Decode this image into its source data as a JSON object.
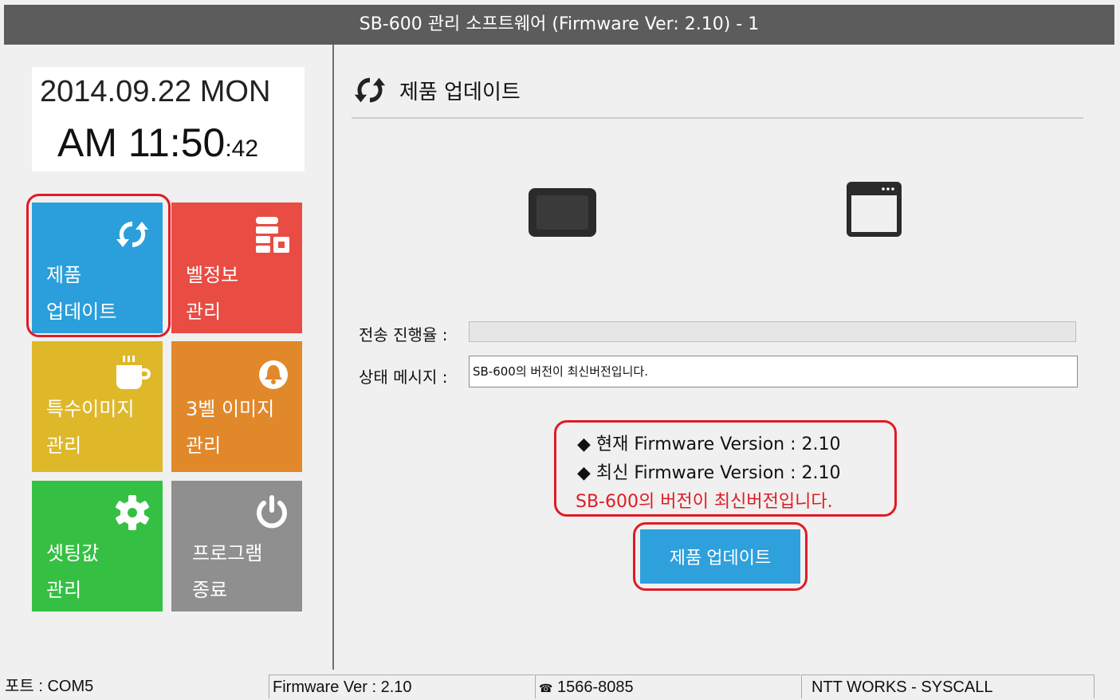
{
  "window": {
    "title": "SB-600 관리 소프트웨어 (Firmware Ver: 2.10) - 1"
  },
  "clock": {
    "date": "2014.09.22 MON",
    "time_main": "AM 11:50",
    "seconds": ":42"
  },
  "tiles": [
    {
      "line1": "제품",
      "line2": "업데이트",
      "color": "#2a9fdc",
      "icon": "refresh-icon"
    },
    {
      "line1": "벨정보",
      "line2": "관리",
      "color": "#e84c43",
      "icon": "database-icon"
    },
    {
      "line1": "특수이미지",
      "line2": "관리",
      "color": "#dfb82a",
      "icon": "coffee-cup-icon"
    },
    {
      "line1": "3벨 이미지",
      "line2": "관리",
      "color": "#e1882a",
      "icon": "bell-icon"
    },
    {
      "line1": "셋팅값",
      "line2": "관리",
      "color": "#35c043",
      "icon": "gear-icon"
    },
    {
      "line1": "프로그램",
      "line2": "종료",
      "color": "#8f8f8f",
      "icon": "power-icon"
    }
  ],
  "main": {
    "section_title": "제품 업데이트",
    "progress_label": "전송 진행율 :",
    "progress_value": 0,
    "status_label": "상태 메시지 :",
    "status_message": "SB-600의 버전이 최신버전입니다.",
    "current_version": "◆ 현재 Firmware Version : 2.10",
    "latest_version": "◆ 최신 Firmware Version : 2.10",
    "version_note": "SB-600의 버전이 최신버전입니다.",
    "update_button": "제품 업데이트"
  },
  "statusbar": {
    "port": "포트 : COM5",
    "firmware": "Firmware Ver : 2.10",
    "phone": "1566-8085",
    "company": "NTT WORKS - SYSCALL"
  },
  "colors": {
    "highlight": "#e01b24",
    "accent": "#2ea0dc",
    "titlebar": "#5c5c5c"
  }
}
